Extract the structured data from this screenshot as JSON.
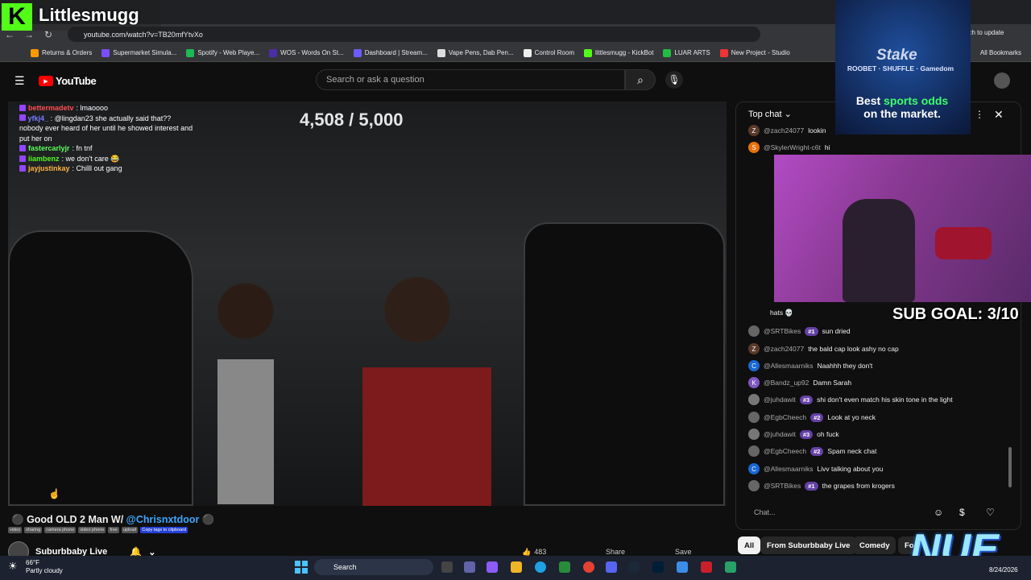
{
  "browser": {
    "url": "youtube.com/watch?v=TB20mfYtvXo",
    "update_btn": "nch to update",
    "all_bookmarks": "All Bookmarks",
    "bookmarks": [
      {
        "label": "Returns & Orders",
        "color": "#ff9900"
      },
      {
        "label": "Supermarket Simula...",
        "color": "#7a4dff"
      },
      {
        "label": "Spotify - Web Playe...",
        "color": "#1db954"
      },
      {
        "label": "WOS - Words On St...",
        "color": "#4a2ea8"
      },
      {
        "label": "Dashboard | Stream...",
        "color": "#6b5cff"
      },
      {
        "label": "Vape Pens, Dab Pen...",
        "color": "#dddddd"
      },
      {
        "label": "Control Room",
        "color": "#eeeeee"
      },
      {
        "label": "littlesmugg - KickBot",
        "color": "#53fc18"
      },
      {
        "label": "LUAR ARTS",
        "color": "#22bb44"
      },
      {
        "label": "New Project - Studio",
        "color": "#e33"
      }
    ]
  },
  "youtube": {
    "logo": "YouTube",
    "search_placeholder": "Search or ask a question"
  },
  "video": {
    "goal_text": "4,508 / 5,000",
    "title_prefix": "Good OLD 2 Man W/ ",
    "title_mention": "@Chrisnxtdoor",
    "tags": [
      "video",
      "sharing",
      "camera phone",
      "video phone",
      "free",
      "upload"
    ],
    "copy_tags": "Copy tags to clipboard",
    "channel": "Suburbbaby Live"
  },
  "stream_chat": [
    {
      "name": "bettermadetv",
      "text": ": lmaoooo",
      "color": "#ff4f4f"
    },
    {
      "name": "yfkj4_",
      "text": ": @lingdan23 she actually said that?? nobody ever heard of her until he showed interest and put her on",
      "color": "#7a7aff"
    },
    {
      "name": "fastercarlyjr",
      "text": ": fn tnf",
      "color": "#5cff5c"
    },
    {
      "name": "iiambenz",
      "text": ": we don't care 😂",
      "color": "#53fc18"
    },
    {
      "name": "jayjustinkay",
      "text": ": Chilll out gang",
      "color": "#ffb340"
    }
  ],
  "live_chat": {
    "header": "Top chat",
    "input_placeholder": "Chat...",
    "messages": [
      {
        "avatar": "Z",
        "avatar_color": "#5a3a2a",
        "name": "@zach24077",
        "badge": "",
        "text": "lookin"
      },
      {
        "avatar": "S",
        "avatar_color": "#e8710a",
        "name": "@SkylerWright-c6t",
        "badge": "",
        "text": "hi"
      },
      {
        "avatar": "",
        "avatar_color": "#555",
        "name": "",
        "badge": "",
        "text": "hats 💀"
      },
      {
        "avatar": "",
        "avatar_color": "#666",
        "name": "@SRTBikes",
        "badge": "#1",
        "text": "sun dried"
      },
      {
        "avatar": "Z",
        "avatar_color": "#5a3a2a",
        "name": "@zach24077",
        "badge": "",
        "text": "the bald cap look ashy no cap"
      },
      {
        "avatar": "C",
        "avatar_color": "#1967d2",
        "name": "@Allesmaarniks",
        "badge": "",
        "text": "Naahhh they don't"
      },
      {
        "avatar": "K",
        "avatar_color": "#7e57c2",
        "name": "@Bandz_up92",
        "badge": "",
        "text": "Damn Sarah"
      },
      {
        "avatar": "",
        "avatar_color": "#777",
        "name": "@juhdawit",
        "badge": "#3",
        "text": "shi don't even match his skin tone in the light"
      },
      {
        "avatar": "",
        "avatar_color": "#666",
        "name": "@EgbCheech",
        "badge": "#2",
        "text": "Look at yo neck"
      },
      {
        "avatar": "",
        "avatar_color": "#777",
        "name": "@juhdawit",
        "badge": "#3",
        "text": "oh fuck"
      },
      {
        "avatar": "",
        "avatar_color": "#666",
        "name": "@EgbCheech",
        "badge": "#2",
        "text": "Spam neck chat"
      },
      {
        "avatar": "C",
        "avatar_color": "#1967d2",
        "name": "@Allesmaarniks",
        "badge": "",
        "text": "Livv talking about you"
      },
      {
        "avatar": "",
        "avatar_color": "#666",
        "name": "@SRTBikes",
        "badge": "#1",
        "text": "the grapes from krogers"
      }
    ]
  },
  "chips": [
    "All",
    "From Suburbbaby Live",
    "Comedy",
    "Fo"
  ],
  "actions": {
    "likes": "483",
    "share": "Share",
    "save": "Save"
  },
  "overlay": {
    "brand": "Littlesmugg",
    "brand_k": "K",
    "ad_stake": "Stake",
    "ad_partners": "ROOBET · SHUFFLE · Gamedom",
    "ad_line1_prefix": "Best ",
    "ad_line1_green": "sports odds",
    "ad_line2": "on the market.",
    "sub_goal": "SUB GOAL: 3/10",
    "nue": "NUE"
  },
  "taskbar": {
    "temp": "66°F",
    "weather": "Partly cloudy",
    "search": "Search",
    "date": "8/24/2026"
  }
}
